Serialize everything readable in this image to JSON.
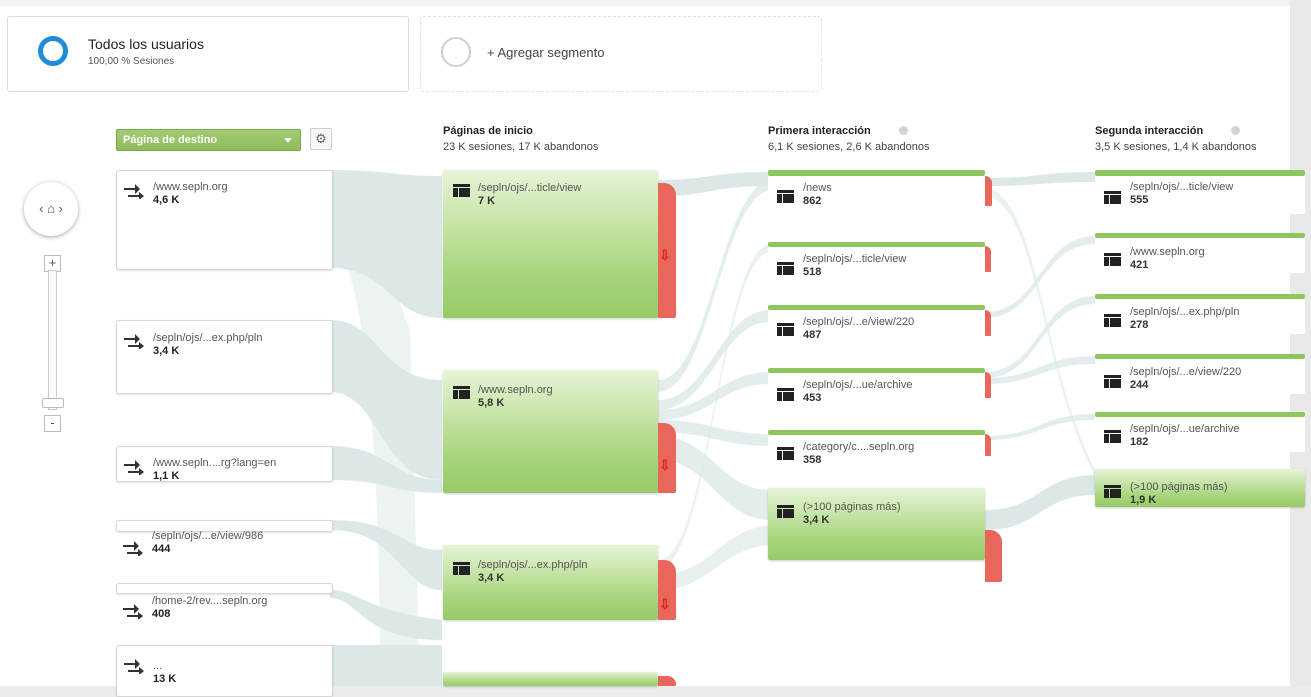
{
  "segments": {
    "all_users_title": "Todos los usuarios",
    "all_users_sub": "100,00 % Sesiones",
    "add_segment": "+ Agregar segmento"
  },
  "controls": {
    "dimension_select": "Página de destino",
    "gear_icon": "gear-icon",
    "home_icon": "home-icon",
    "zoom_in": "+",
    "zoom_out": "-"
  },
  "columns": [
    {
      "title": "Páginas de inicio",
      "subtitle": "23 K sesiones, 17 K abandonos"
    },
    {
      "title": "Primera interacción",
      "subtitle": "6,1 K sesiones, 2,6 K abandonos"
    },
    {
      "title": "Segunda interacción",
      "subtitle": "3,5 K sesiones, 1,4 K abandonos"
    }
  ],
  "sources": [
    {
      "label": "/www.sepln.org",
      "count": "4,6 K"
    },
    {
      "label": "/sepln/ojs/...ex.php/pln",
      "count": "3,4 K"
    },
    {
      "label": "/www.sepln....rg?lang=en",
      "count": "1,1 K"
    },
    {
      "label": "/sepln/ojs/...e/view/986",
      "count": "444"
    },
    {
      "label": "/home-2/rev....sepln.org",
      "count": "408"
    },
    {
      "label": "...",
      "count": "13 K"
    }
  ],
  "start_pages": [
    {
      "label": "/sepln/ojs/...ticle/view",
      "count": "7 K"
    },
    {
      "label": "/www.sepln.org",
      "count": "5,8 K"
    },
    {
      "label": "/sepln/ojs/...ex.php/pln",
      "count": "3,4 K"
    }
  ],
  "first_interaction": [
    {
      "label": "/news",
      "count": "862"
    },
    {
      "label": "/sepln/ojs/...ticle/view",
      "count": "518"
    },
    {
      "label": "/sepln/ojs/...e/view/220",
      "count": "487"
    },
    {
      "label": "/sepln/ojs/...ue/archive",
      "count": "453"
    },
    {
      "label": "/category/c....sepln.org",
      "count": "358"
    },
    {
      "label": "(>100 páginas más)",
      "count": "3,4 K"
    }
  ],
  "second_interaction": [
    {
      "label": "/sepln/ojs/...ticle/view",
      "count": "555"
    },
    {
      "label": "/www.sepln.org",
      "count": "421"
    },
    {
      "label": "/sepln/ojs/...ex.php/pln",
      "count": "278"
    },
    {
      "label": "/sepln/ojs/...e/view/220",
      "count": "244"
    },
    {
      "label": "/sepln/ojs/...ue/archive",
      "count": "182"
    },
    {
      "label": "(>100 páginas más)",
      "count": "1,9 K"
    }
  ],
  "colors": {
    "node_green": "#97ca68",
    "dropoff_red": "#e8665a",
    "flow": "#d6e4e4",
    "accent_blue": "#1f8dd6"
  }
}
